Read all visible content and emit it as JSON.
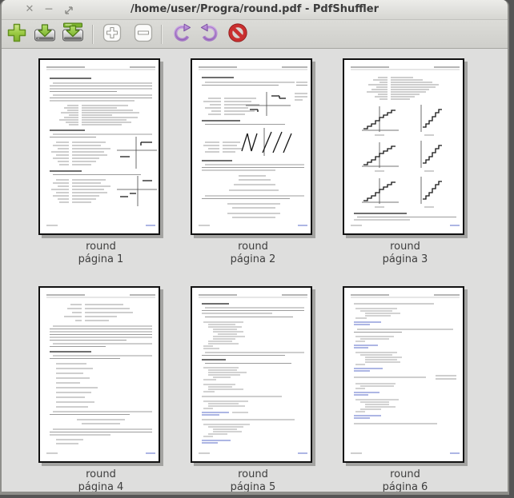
{
  "window": {
    "title": "/home/user/Progra/round.pdf - PdfShuffler",
    "controls": {
      "close": "✕",
      "minimize": "─"
    }
  },
  "toolbar": {
    "buttons": [
      {
        "id": "add-file",
        "icon": "plus-icon"
      },
      {
        "id": "save",
        "icon": "save-icon"
      },
      {
        "id": "save-as",
        "icon": "save-as-icon"
      },
      {
        "id": "zoom-in",
        "icon": "zoom-in-icon"
      },
      {
        "id": "zoom-out",
        "icon": "zoom-out-icon"
      },
      {
        "id": "rotate-left",
        "icon": "rotate-left-icon"
      },
      {
        "id": "rotate-right",
        "icon": "rotate-right-icon"
      },
      {
        "id": "delete",
        "icon": "delete-stop-icon"
      }
    ]
  },
  "thumbnails": [
    {
      "title": "round",
      "page_label": "página 1"
    },
    {
      "title": "round",
      "page_label": "página 2"
    },
    {
      "title": "round",
      "page_label": "página 3"
    },
    {
      "title": "round",
      "page_label": "página 4"
    },
    {
      "title": "round",
      "page_label": "página 5"
    },
    {
      "title": "round",
      "page_label": "página 6"
    }
  ],
  "colors": {
    "accent_green": "#8cc63e",
    "accent_purple": "#b48ad2",
    "accent_red": "#c92f2f",
    "canvas_bg": "#dededd",
    "titlebar_text": "#3c3c3c"
  }
}
